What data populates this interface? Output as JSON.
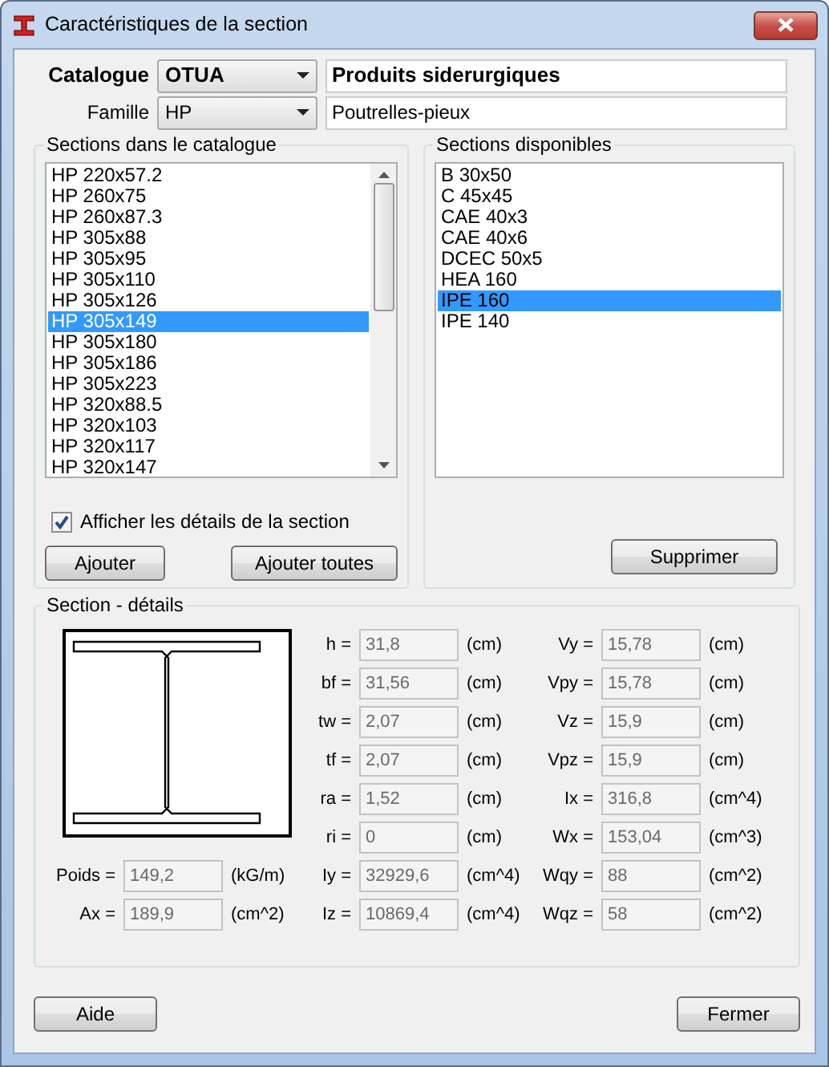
{
  "window": {
    "title": "Caractéristiques de la section"
  },
  "catalogue": {
    "label": "Catalogue",
    "value": "OTUA",
    "description": "Produits siderurgiques"
  },
  "famille": {
    "label": "Famille",
    "value": "HP",
    "description": "Poutrelles-pieux"
  },
  "catalog_sections": {
    "title": "Sections dans le catalogue",
    "items": [
      {
        "label": "HP 220x57.2",
        "selected": false
      },
      {
        "label": "HP 260x75",
        "selected": false
      },
      {
        "label": "HP 260x87.3",
        "selected": false
      },
      {
        "label": "HP 305x88",
        "selected": false
      },
      {
        "label": "HP 305x95",
        "selected": false
      },
      {
        "label": "HP 305x110",
        "selected": false
      },
      {
        "label": "HP 305x126",
        "selected": false
      },
      {
        "label": "HP 305x149",
        "selected": true
      },
      {
        "label": "HP 305x180",
        "selected": false
      },
      {
        "label": "HP 305x186",
        "selected": false
      },
      {
        "label": "HP 305x223",
        "selected": false
      },
      {
        "label": "HP 320x88.5",
        "selected": false
      },
      {
        "label": "HP 320x103",
        "selected": false
      },
      {
        "label": "HP 320x117",
        "selected": false
      },
      {
        "label": "HP 320x147",
        "selected": false
      }
    ],
    "show_details": {
      "label": "Afficher les détails de la section",
      "checked": true
    },
    "buttons": [
      "Ajouter",
      "Ajouter toutes"
    ]
  },
  "available_sections": {
    "title": "Sections disponibles",
    "items": [
      {
        "label": "B 30x50",
        "selected": false
      },
      {
        "label": "C 45x45",
        "selected": false
      },
      {
        "label": "CAE 40x3",
        "selected": false
      },
      {
        "label": "CAE 40x6",
        "selected": false
      },
      {
        "label": "DCEC 50x5",
        "selected": false
      },
      {
        "label": "HEA 160",
        "selected": false
      },
      {
        "label": "IPE 160",
        "selected": true
      },
      {
        "label": "IPE 140",
        "selected": false
      }
    ],
    "buttons": [
      "Supprimer"
    ]
  },
  "details": {
    "title": "Section - détails",
    "left": [
      {
        "label": "Poids =",
        "value": "149,2",
        "unit": "(kG/m)"
      },
      {
        "label": "Ax =",
        "value": "189,9",
        "unit": "(cm^2)"
      }
    ],
    "middle": [
      {
        "label": "h =",
        "value": "31,8",
        "unit": "(cm)"
      },
      {
        "label": "bf =",
        "value": "31,56",
        "unit": "(cm)"
      },
      {
        "label": "tw =",
        "value": "2,07",
        "unit": "(cm)"
      },
      {
        "label": "tf =",
        "value": "2,07",
        "unit": "(cm)"
      },
      {
        "label": "ra =",
        "value": "1,52",
        "unit": "(cm)"
      },
      {
        "label": "ri =",
        "value": "0",
        "unit": "(cm)"
      },
      {
        "label": "Iy =",
        "value": "32929,6",
        "unit": "(cm^4)"
      },
      {
        "label": "Iz =",
        "value": "10869,4",
        "unit": "(cm^4)"
      }
    ],
    "right": [
      {
        "label": "Vy =",
        "value": "15,78",
        "unit": "(cm)"
      },
      {
        "label": "Vpy =",
        "value": "15,78",
        "unit": "(cm)"
      },
      {
        "label": "Vz =",
        "value": "15,9",
        "unit": "(cm)"
      },
      {
        "label": "Vpz =",
        "value": "15,9",
        "unit": "(cm)"
      },
      {
        "label": "Ix =",
        "value": "316,8",
        "unit": "(cm^4)"
      },
      {
        "label": "Wx =",
        "value": "153,04",
        "unit": "(cm^3)"
      },
      {
        "label": "Wqy =",
        "value": "88",
        "unit": "(cm^2)"
      },
      {
        "label": "Wqz =",
        "value": "58",
        "unit": "(cm^2)"
      }
    ]
  },
  "footer_buttons": [
    "Aide",
    "Fermer"
  ]
}
